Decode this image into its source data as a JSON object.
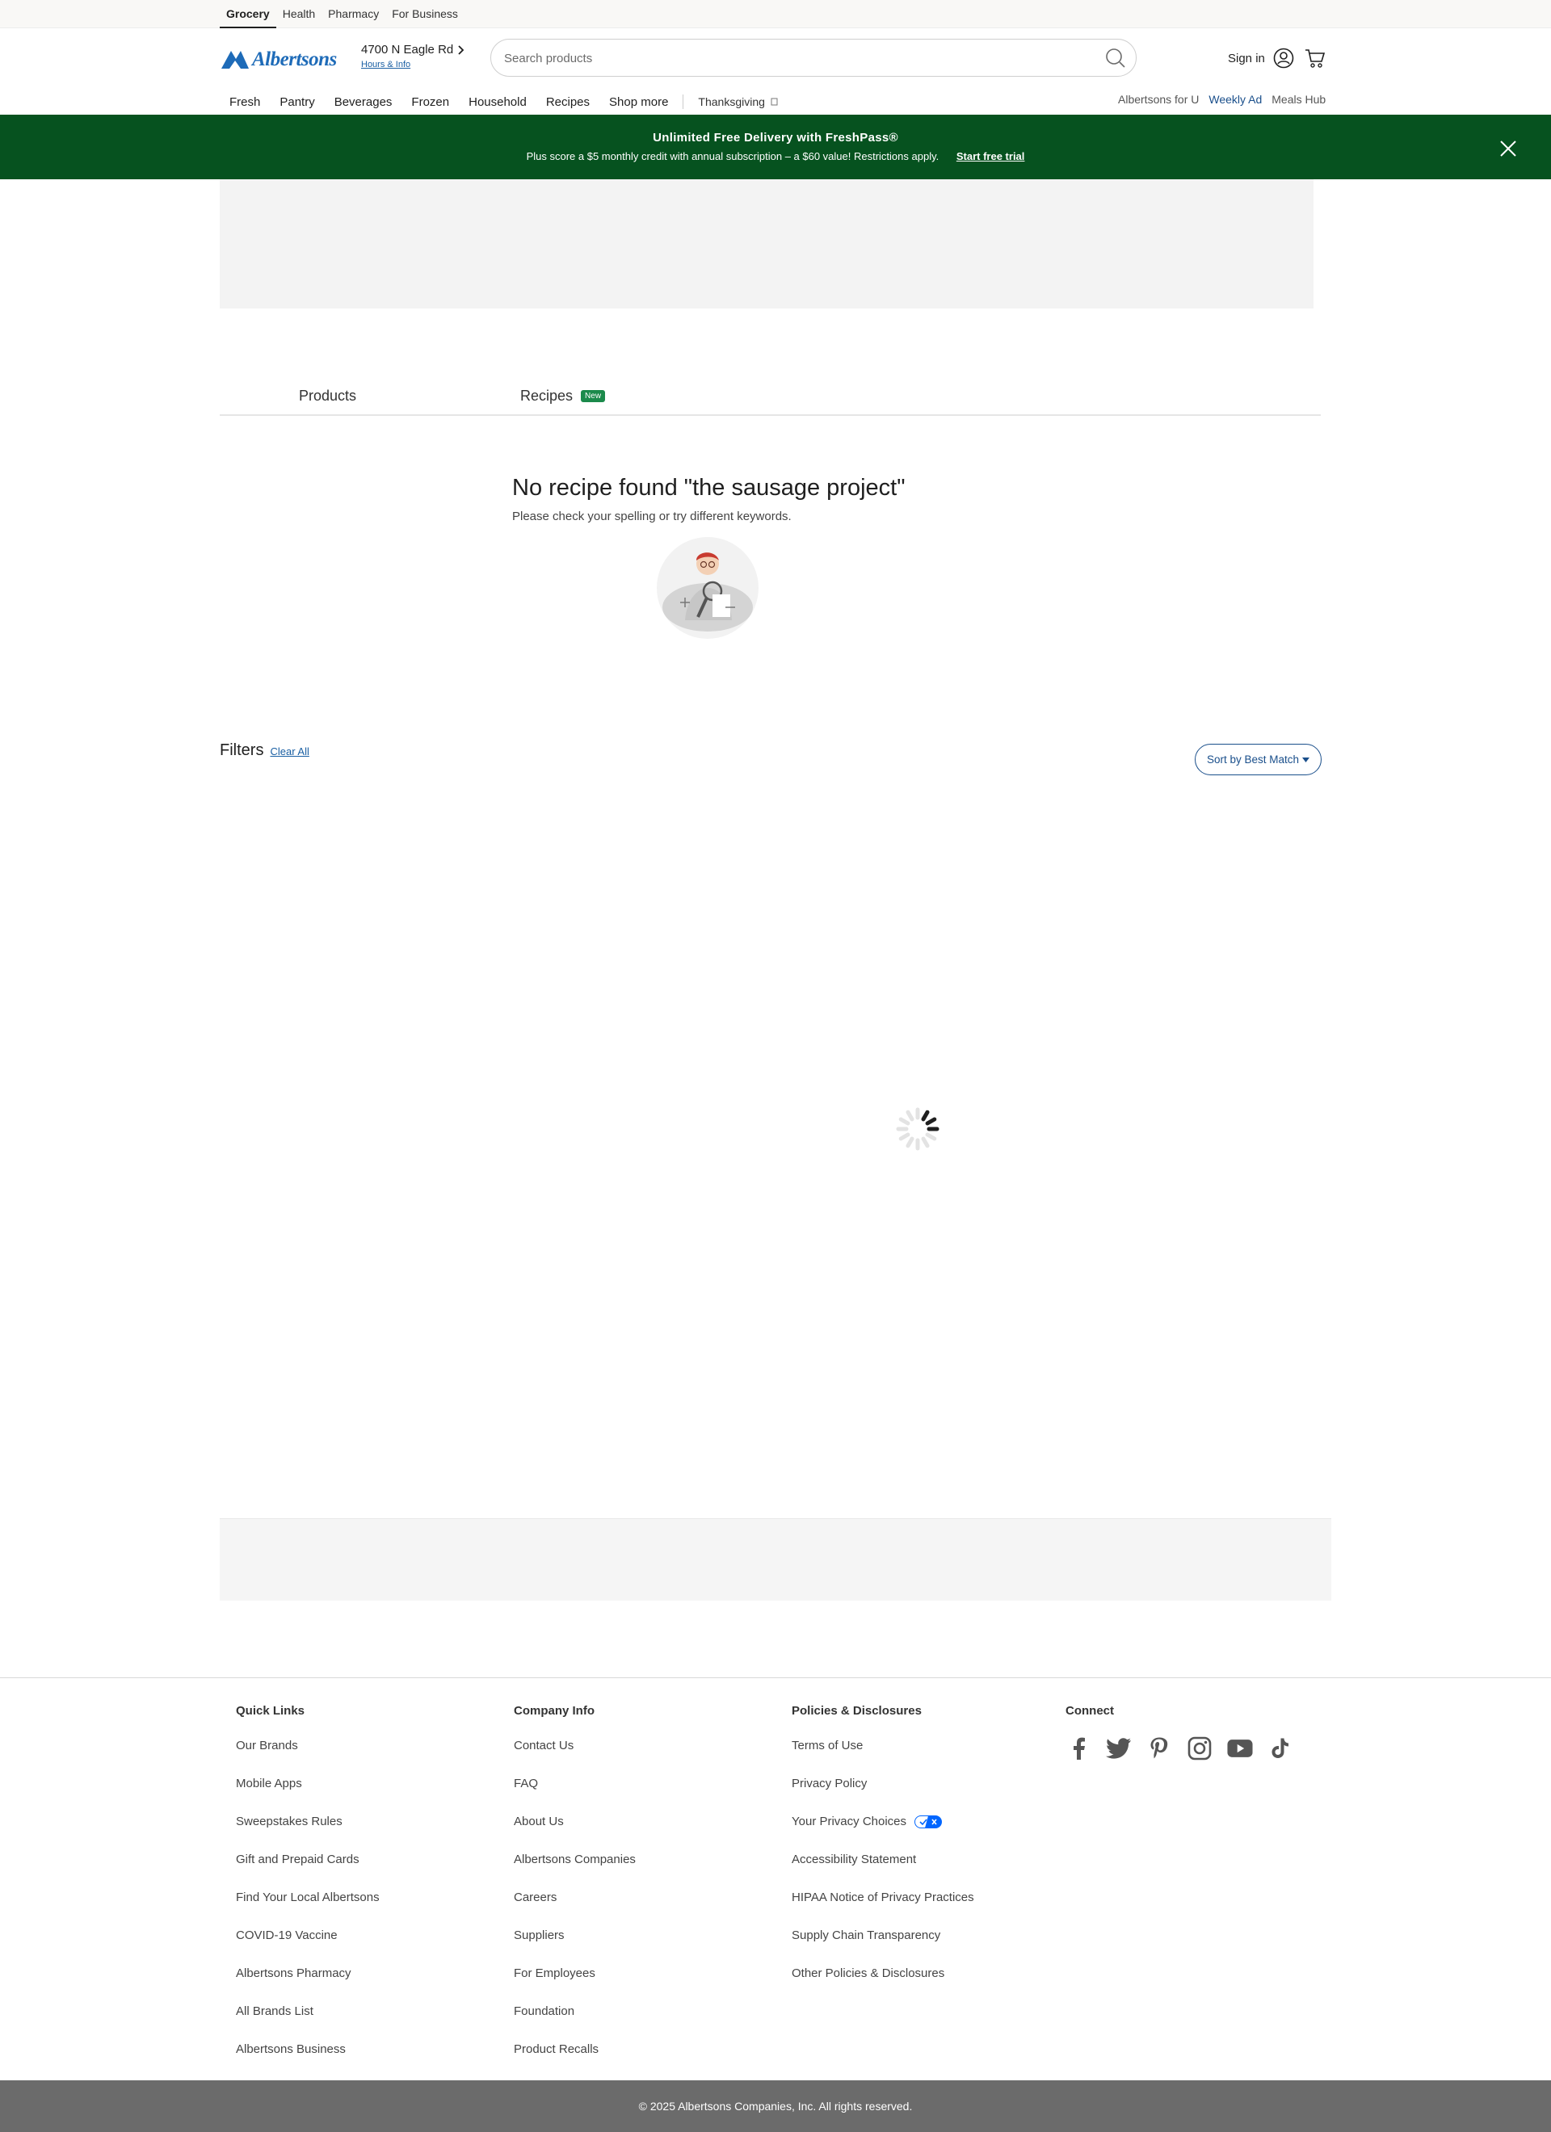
{
  "top_tabs": [
    "Grocery",
    "Health",
    "Pharmacy",
    "For Business"
  ],
  "header": {
    "brand": "Albertsons",
    "store_address": "4700 N Eagle Rd",
    "store_link": "Hours & Info",
    "search_placeholder": "Search products",
    "sign_in": "Sign in"
  },
  "nav": {
    "items": [
      "Fresh",
      "Pantry",
      "Beverages",
      "Frozen",
      "Household",
      "Recipes",
      "Shop more"
    ],
    "seasonal": "Thanksgiving",
    "right": [
      "Albertsons for U",
      "Weekly Ad",
      "Meals Hub"
    ]
  },
  "promo": {
    "title": "Unlimited Free Delivery with FreshPass®",
    "subtitle": "Plus score a $5 monthly credit with annual subscription – a $60 value! Restrictions apply.",
    "cta": "Start free trial"
  },
  "result_tabs": {
    "products": "Products",
    "recipes": "Recipes",
    "recipes_badge": "New"
  },
  "empty_state": {
    "title": "No recipe found \"the sausage project\"",
    "subtitle": "Please check your spelling or try different keywords."
  },
  "filters": {
    "title": "Filters",
    "clear": "Clear All",
    "sort": "Sort by Best Match"
  },
  "footer": {
    "quick_links": {
      "title": "Quick Links",
      "items": [
        "Our Brands",
        "Mobile Apps",
        "Sweepstakes Rules",
        "Gift and Prepaid Cards",
        "Find Your Local Albertsons",
        "COVID-19 Vaccine",
        "Albertsons Pharmacy",
        "All Brands List",
        "Albertsons Business"
      ]
    },
    "company_info": {
      "title": "Company Info",
      "items": [
        "Contact Us",
        "FAQ",
        "About Us",
        "Albertsons Companies",
        "Careers",
        "Suppliers",
        "For Employees",
        "Foundation",
        "Product Recalls"
      ]
    },
    "policies": {
      "title": "Policies & Disclosures",
      "items": [
        "Terms of Use",
        "Privacy Policy",
        "Your Privacy Choices",
        "Accessibility Statement",
        "HIPAA Notice of Privacy Practices",
        "Supply Chain Transparency",
        "Other Policies & Disclosures"
      ]
    },
    "connect": {
      "title": "Connect",
      "icons": [
        "facebook-icon",
        "twitter-icon",
        "pinterest-icon",
        "instagram-icon",
        "youtube-icon",
        "tiktok-icon"
      ]
    },
    "copyright": "© 2025 Albertsons Companies, Inc.  All rights reserved."
  },
  "colors": {
    "brand_blue": "#1e6bb8",
    "promo_green": "#06521f",
    "link_blue": "#1a5fa3"
  }
}
